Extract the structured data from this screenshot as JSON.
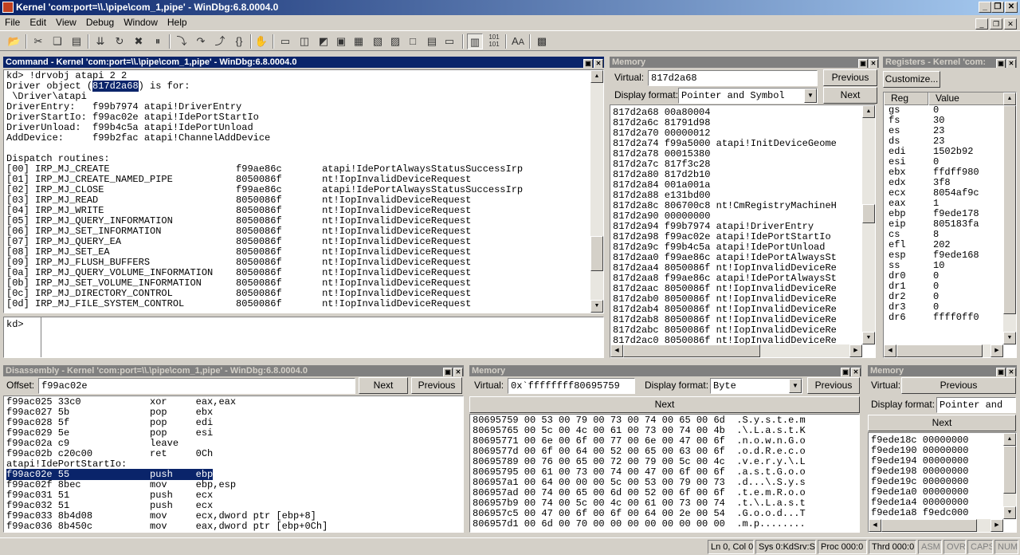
{
  "window": {
    "title": "Kernel 'com:port=\\\\.\\pipe\\com_1,pipe' - WinDbg:6.8.0004.0",
    "min": "_",
    "restore": "❐",
    "close": "✕"
  },
  "menu": [
    "File",
    "Edit",
    "View",
    "Debug",
    "Window",
    "Help"
  ],
  "toolbar_icons": [
    "open-icon",
    "cut-icon",
    "copy-icon",
    "paste-icon",
    "go-icon",
    "restart-icon",
    "stop-debugging-icon",
    "break-icon",
    "step-into-icon",
    "step-over-icon",
    "step-out-icon",
    "run-to-cursor-icon",
    "hand-icon",
    "command-window-icon",
    "watch-icon",
    "locals-icon",
    "registers-icon",
    "memory-icon",
    "call-stack-icon",
    "disassembly-icon",
    "scratch-pad-icon",
    "processes-icon",
    "source-mode-icon",
    "hex-mode-icon",
    "font-icon",
    "options-icon"
  ],
  "command": {
    "title": "Command - Kernel 'com:port=\\\\.\\pipe\\com_1,pipe' - WinDbg:6.8.0004.0",
    "lines": [
      {
        "t": "kd> !drvobj atapi 2 2"
      },
      {
        "pre": "Driver object (",
        "hl": "817d2a68",
        "post": ") is for:"
      },
      {
        "t": " \\Driver\\atapi"
      },
      {
        "t": "DriverEntry:   f99b7974 atapi!DriverEntry"
      },
      {
        "t": "DriverStartIo: f99ac02e atapi!IdePortStartIo"
      },
      {
        "t": "DriverUnload:  f99b4c5a atapi!IdePortUnload"
      },
      {
        "t": "AddDevice:     f99b2fac atapi!ChannelAddDevice"
      },
      {
        "t": ""
      },
      {
        "t": "Dispatch routines:"
      },
      {
        "t": "[00] IRP_MJ_CREATE                      f99ae86c       atapi!IdePortAlwaysStatusSuccessIrp"
      },
      {
        "t": "[01] IRP_MJ_CREATE_NAMED_PIPE           8050086f       nt!IopInvalidDeviceRequest"
      },
      {
        "t": "[02] IRP_MJ_CLOSE                       f99ae86c       atapi!IdePortAlwaysStatusSuccessIrp"
      },
      {
        "t": "[03] IRP_MJ_READ                        8050086f       nt!IopInvalidDeviceRequest"
      },
      {
        "t": "[04] IRP_MJ_WRITE                       8050086f       nt!IopInvalidDeviceRequest"
      },
      {
        "t": "[05] IRP_MJ_QUERY_INFORMATION           8050086f       nt!IopInvalidDeviceRequest"
      },
      {
        "t": "[06] IRP_MJ_SET_INFORMATION             8050086f       nt!IopInvalidDeviceRequest"
      },
      {
        "t": "[07] IRP_MJ_QUERY_EA                    8050086f       nt!IopInvalidDeviceRequest"
      },
      {
        "t": "[08] IRP_MJ_SET_EA                      8050086f       nt!IopInvalidDeviceRequest"
      },
      {
        "t": "[09] IRP_MJ_FLUSH_BUFFERS               8050086f       nt!IopInvalidDeviceRequest"
      },
      {
        "t": "[0a] IRP_MJ_QUERY_VOLUME_INFORMATION    8050086f       nt!IopInvalidDeviceRequest"
      },
      {
        "t": "[0b] IRP_MJ_SET_VOLUME_INFORMATION      8050086f       nt!IopInvalidDeviceRequest"
      },
      {
        "t": "[0c] IRP_MJ_DIRECTORY_CONTROL           8050086f       nt!IopInvalidDeviceRequest"
      },
      {
        "t": "[0d] IRP_MJ_FILE_SYSTEM_CONTROL         8050086f       nt!IopInvalidDeviceRequest"
      }
    ],
    "prompt": "kd>"
  },
  "memory1": {
    "title": "Memory",
    "virtual_label": "Virtual:",
    "virtual": "817d2a68",
    "previous": "Previous",
    "next": "Next",
    "format_label": "Display format:",
    "format": "Pointer and Symbol",
    "lines": [
      "817d2a68 00a80004",
      "817d2a6c 81791d98",
      "817d2a70 00000012",
      "817d2a74 f99a5000 atapi!InitDeviceGeome",
      "817d2a78 00015380",
      "817d2a7c 817f3c28",
      "817d2a80 817d2b10",
      "817d2a84 001a001a",
      "817d2a88 e131bd00",
      "817d2a8c 806700c8 nt!CmRegistryMachineH",
      "817d2a90 00000000",
      "817d2a94 f99b7974 atapi!DriverEntry",
      "817d2a98 f99ac02e atapi!IdePortStartIo",
      "817d2a9c f99b4c5a atapi!IdePortUnload",
      "817d2aa0 f99ae86c atapi!IdePortAlwaysSt",
      "817d2aa4 8050086f nt!IopInvalidDeviceRe",
      "817d2aa8 f99ae86c atapi!IdePortAlwaysSt",
      "817d2aac 8050086f nt!IopInvalidDeviceRe",
      "817d2ab0 8050086f nt!IopInvalidDeviceRe",
      "817d2ab4 8050086f nt!IopInvalidDeviceRe",
      "817d2ab8 8050086f nt!IopInvalidDeviceRe",
      "817d2abc 8050086f nt!IopInvalidDeviceRe",
      "817d2ac0 8050086f nt!IopInvalidDeviceRe"
    ]
  },
  "registers": {
    "title": "Registers - Kernel 'com:",
    "customize": "Customize...",
    "col_reg": "Reg",
    "col_value": "Value",
    "rows": [
      [
        "gs",
        "0"
      ],
      [
        "fs",
        "30"
      ],
      [
        "es",
        "23"
      ],
      [
        "ds",
        "23"
      ],
      [
        "edi",
        "1502b92"
      ],
      [
        "esi",
        "0"
      ],
      [
        "ebx",
        "ffdff980"
      ],
      [
        "edx",
        "3f8"
      ],
      [
        "ecx",
        "8054af9c"
      ],
      [
        "eax",
        "1"
      ],
      [
        "ebp",
        "f9ede178"
      ],
      [
        "eip",
        "805183fa"
      ],
      [
        "cs",
        "8"
      ],
      [
        "efl",
        "202"
      ],
      [
        "esp",
        "f9ede168"
      ],
      [
        "ss",
        "10"
      ],
      [
        "dr0",
        "0"
      ],
      [
        "dr1",
        "0"
      ],
      [
        "dr2",
        "0"
      ],
      [
        "dr3",
        "0"
      ],
      [
        "dr6",
        "ffff0ff0"
      ]
    ]
  },
  "disasm": {
    "title": "Disassembly - Kernel 'com:port=\\\\.\\pipe\\com_1,pipe' - WinDbg:6.8.0004.0",
    "offset_label": "Offset:",
    "offset": "f99ac02e",
    "next": "Next",
    "previous": "Previous",
    "lines": [
      {
        "t": "f99ac025 33c0            xor     eax,eax"
      },
      {
        "t": "f99ac027 5b              pop     ebx"
      },
      {
        "t": "f99ac028 5f              pop     edi"
      },
      {
        "t": "f99ac029 5e              pop     esi"
      },
      {
        "t": "f99ac02a c9              leave"
      },
      {
        "t": "f99ac02b c20c00          ret     0Ch"
      },
      {
        "t": "atapi!IdePortStartIo:"
      },
      {
        "t": "f99ac02e 55              push    ebp",
        "hl": true
      },
      {
        "t": "f99ac02f 8bec            mov     ebp,esp"
      },
      {
        "t": "f99ac031 51              push    ecx"
      },
      {
        "t": "f99ac032 51              push    ecx"
      },
      {
        "t": "f99ac033 8b4d08          mov     ecx,dword ptr [ebp+8]"
      },
      {
        "t": "f99ac036 8b450c          mov     eax,dword ptr [ebp+0Ch]"
      }
    ]
  },
  "memory2": {
    "title": "Memory",
    "virtual_label": "Virtual:",
    "virtual": "0x`ffffffff80695759",
    "format_label": "Display format:",
    "format": "Byte",
    "previous": "Previous",
    "next": "Next",
    "lines": [
      "80695759 00 53 00 79 00 73 00 74 00 65 00 6d  .S.y.s.t.e.m",
      "80695765 00 5c 00 4c 00 61 00 73 00 74 00 4b  .\\.L.a.s.t.K",
      "80695771 00 6e 00 6f 00 77 00 6e 00 47 00 6f  .n.o.w.n.G.o",
      "8069577d 00 6f 00 64 00 52 00 65 00 63 00 6f  .o.d.R.e.c.o",
      "80695789 00 76 00 65 00 72 00 79 00 5c 00 4c  .v.e.r.y.\\.L",
      "80695795 00 61 00 73 00 74 00 47 00 6f 00 6f  .a.s.t.G.o.o",
      "806957a1 00 64 00 00 00 5c 00 53 00 79 00 73  .d...\\.S.y.s",
      "806957ad 00 74 00 65 00 6d 00 52 00 6f 00 6f  .t.e.m.R.o.o",
      "806957b9 00 74 00 5c 00 4c 00 61 00 73 00 74  .t.\\.L.a.s.t",
      "806957c5 00 47 00 6f 00 6f 00 64 00 2e 00 54  .G.o.o.d...T",
      "806957d1 00 6d 00 70 00 00 00 00 00 00 00 00  .m.p........"
    ]
  },
  "memory3": {
    "title": "Memory",
    "virtual_label": "Virtual:",
    "previous": "Previous",
    "format_label": "Display format:",
    "format": "Pointer and",
    "next": "Next",
    "lines": [
      "f9ede18c 00000000",
      "f9ede190 00000000",
      "f9ede194 00000000",
      "f9ede198 00000000",
      "f9ede19c 00000000",
      "f9ede1a0 00000000",
      "f9ede1a4 00000000",
      "f9ede1a8 f9edc000"
    ]
  },
  "status": {
    "pos": "Ln 0, Col 0",
    "sys": "Sys 0:KdSrv:S",
    "proc": "Proc 000:0",
    "thrd": "Thrd 000:0",
    "asm": "ASM",
    "ovr": "OVR",
    "caps": "CAPS",
    "num": "NUM"
  }
}
